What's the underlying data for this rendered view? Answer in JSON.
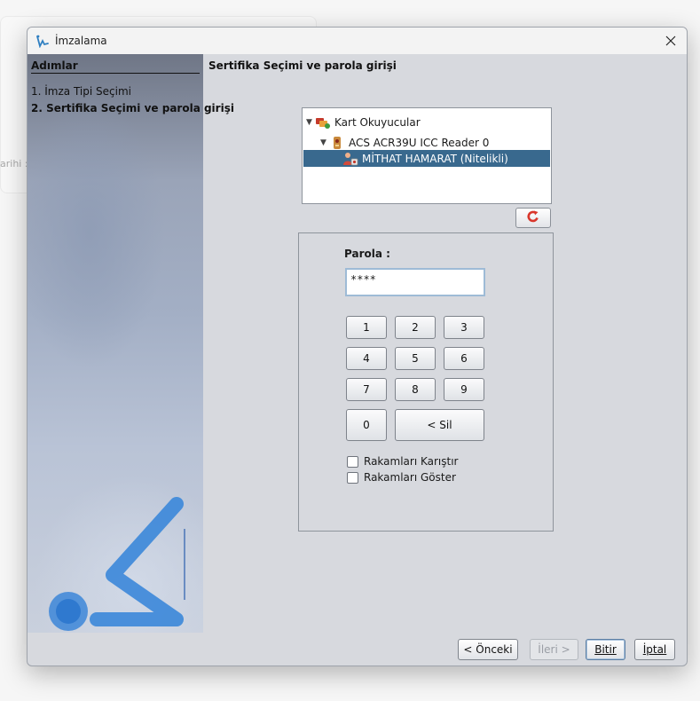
{
  "background": {
    "label": "arihi :"
  },
  "dialog": {
    "title": "İmzalama",
    "steps": {
      "heading": "Adımlar",
      "items": [
        {
          "label": "1. İmza Tipi Seçimi",
          "active": false
        },
        {
          "label": "2. Sertifika Seçimi ve parola girişi",
          "active": true
        }
      ]
    },
    "section_title": "Sertifika Seçimi ve parola girişi",
    "tree": {
      "root": "Kart Okuyucular",
      "reader": "ACS ACR39U ICC Reader 0",
      "certificate": "MİTHAT HAMARAT (Nitelikli)",
      "selected": "MİTHAT HAMARAT (Nitelikli)"
    },
    "password": {
      "label": "Parola :",
      "value": "****"
    },
    "keypad": {
      "keys": [
        "1",
        "2",
        "3",
        "4",
        "5",
        "6",
        "7",
        "8",
        "9",
        "0"
      ],
      "delete_label": "< Sil"
    },
    "options": {
      "shuffle_label": "Rakamları Karıştır",
      "shuffle_checked": false,
      "show_label": "Rakamları Göster",
      "show_checked": false
    },
    "footer": {
      "prev_label": "< Önceki",
      "next_label": "İleri >",
      "finish_label": "Bitir",
      "cancel_label": "İptal"
    },
    "colors": {
      "selection": "#39698e",
      "dialog_bg": "#d7d9de",
      "accent": "#4a90d9"
    }
  }
}
